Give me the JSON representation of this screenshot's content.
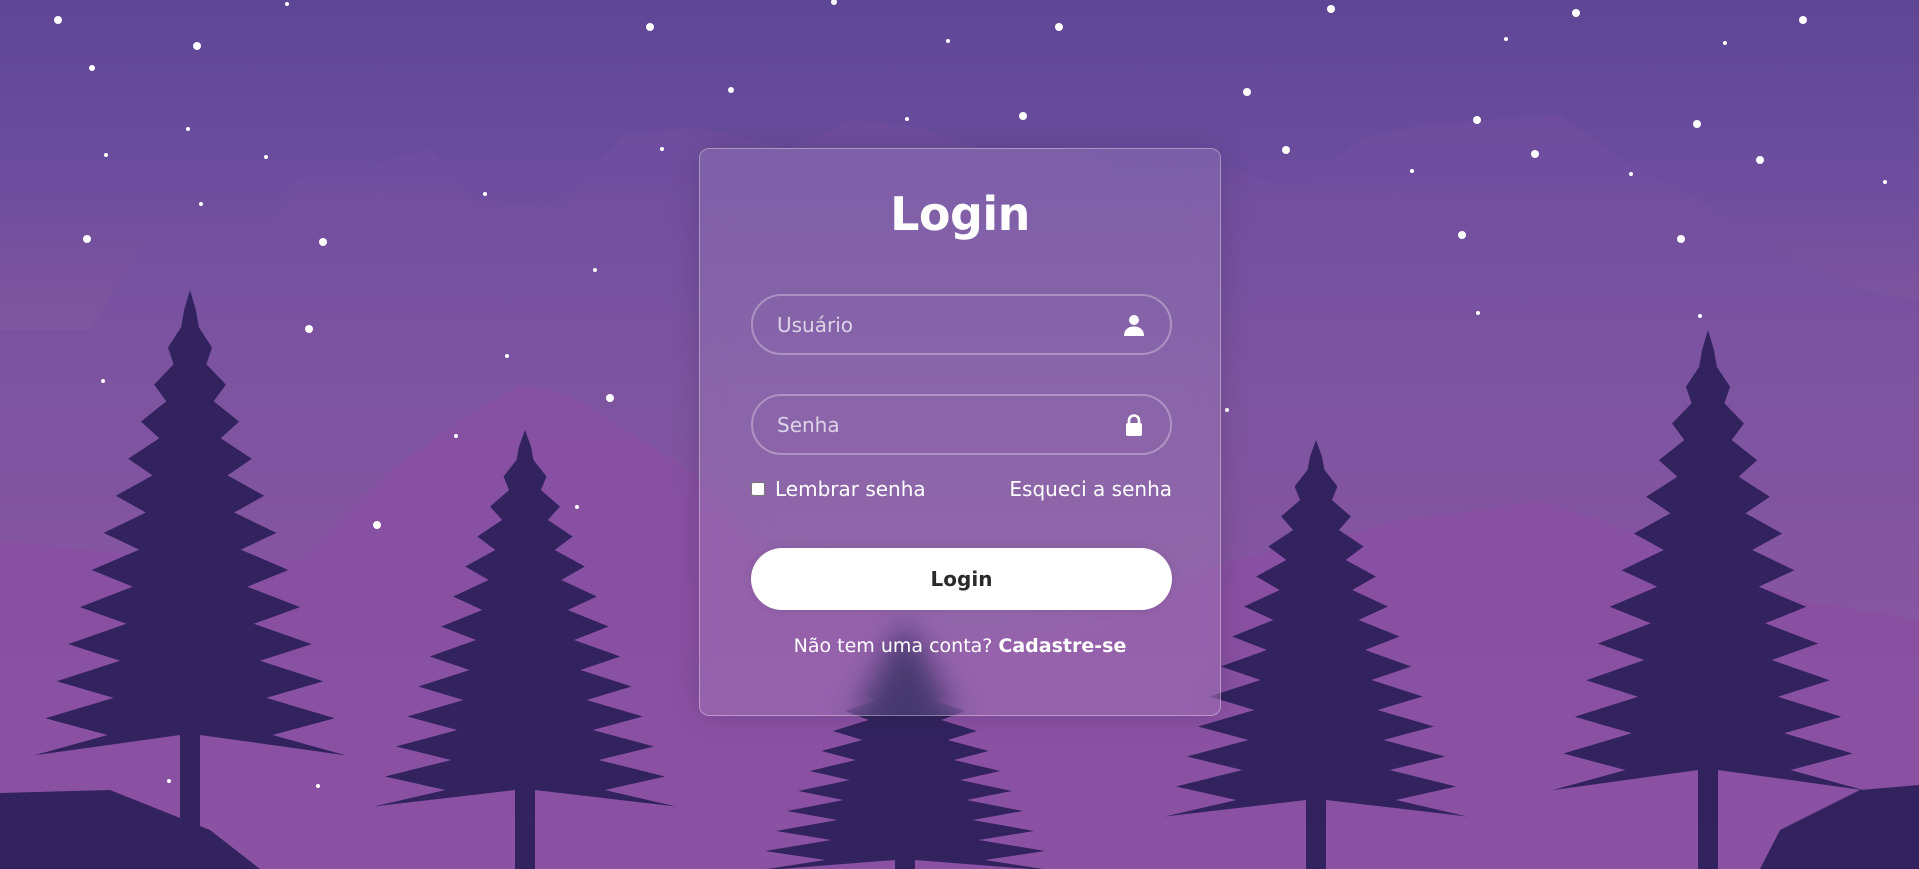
{
  "login": {
    "title": "Login",
    "username": {
      "placeholder": "Usuário",
      "value": "",
      "icon": "user-icon"
    },
    "password": {
      "placeholder": "Senha",
      "value": "",
      "icon": "lock-icon"
    },
    "remember_label": "Lembrar senha",
    "remember_checked": false,
    "forgot_label": "Esqueci a senha",
    "button_label": "Login",
    "register_prompt": "Não tem uma conta?",
    "register_link": "Cadastre-se"
  },
  "colors": {
    "sky_top": "#5e4696",
    "sky_bottom": "#b06aa8",
    "tree": "#32235f",
    "button_bg": "#ffffff",
    "text": "#ffffff"
  }
}
